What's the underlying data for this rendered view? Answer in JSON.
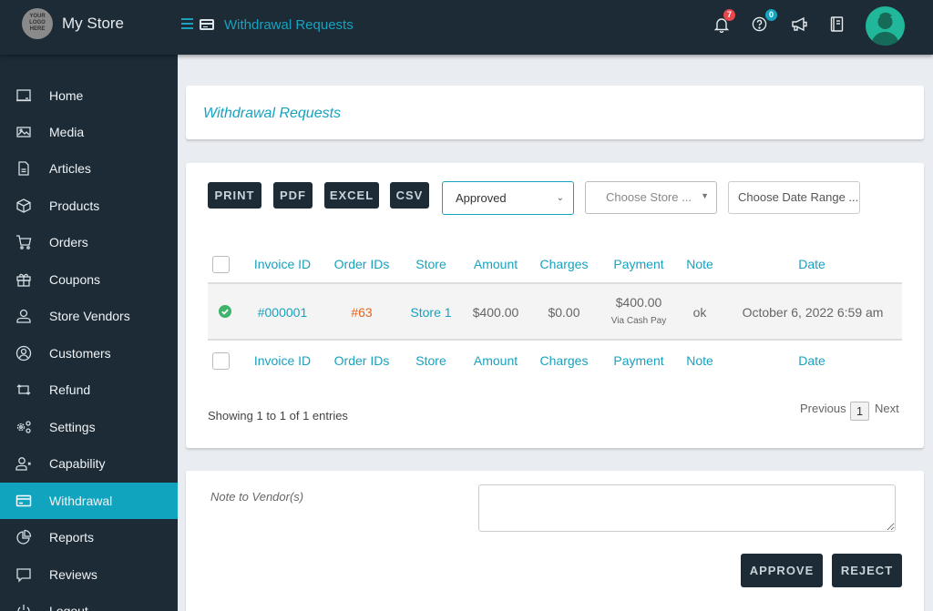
{
  "header": {
    "logo_text": "YOUR LOGO HERE",
    "store_name": "My Store",
    "page_title": "Withdrawal Requests",
    "notifications_count": "7",
    "help_count": "0",
    "colors": {
      "accent": "#17a2c0",
      "dark": "#1c2b36",
      "notif_badge": "#e8474b",
      "help_badge": "#17a2c0",
      "avatar": "#20b79a"
    }
  },
  "sidebar": {
    "items": [
      {
        "label": "Home",
        "icon": "monitor-icon"
      },
      {
        "label": "Media",
        "icon": "image-icon"
      },
      {
        "label": "Articles",
        "icon": "document-icon"
      },
      {
        "label": "Products",
        "icon": "box-icon"
      },
      {
        "label": "Orders",
        "icon": "cart-icon"
      },
      {
        "label": "Coupons",
        "icon": "gift-icon"
      },
      {
        "label": "Store Vendors",
        "icon": "user-icon"
      },
      {
        "label": "Customers",
        "icon": "user-circle-icon"
      },
      {
        "label": "Refund",
        "icon": "refund-icon"
      },
      {
        "label": "Settings",
        "icon": "gears-icon"
      },
      {
        "label": "Capability",
        "icon": "user-x-icon"
      },
      {
        "label": "Withdrawal",
        "icon": "credit-card-icon",
        "active": true
      },
      {
        "label": "Reports",
        "icon": "pie-chart-icon"
      },
      {
        "label": "Reviews",
        "icon": "comment-icon"
      },
      {
        "label": "Logout",
        "icon": "power-icon"
      }
    ]
  },
  "title_card": {
    "title": "Withdrawal Requests"
  },
  "toolbar": {
    "print": "PRINT",
    "pdf": "PDF",
    "excel": "EXCEL",
    "csv": "CSV",
    "status_select": "Approved",
    "store_placeholder": "Choose Store ...",
    "date_range_placeholder": "Choose Date Range ..."
  },
  "table": {
    "columns": [
      "Invoice ID",
      "Order IDs",
      "Store",
      "Amount",
      "Charges",
      "Payment",
      "Note",
      "Date"
    ],
    "rows": [
      {
        "status": "approved",
        "invoice_id": "#000001",
        "order_ids": "#63",
        "store": "Store 1",
        "amount": "$400.00",
        "charges": "$0.00",
        "payment": "$400.00",
        "payment_method": "Via Cash Pay",
        "note": "ok",
        "date": "October 6, 2022 6:59 am"
      }
    ],
    "info": "Showing 1 to 1 of 1 entries",
    "pagination": {
      "previous": "Previous",
      "current": "1",
      "next": "Next"
    }
  },
  "note_card": {
    "label": "Note to Vendor(s)",
    "value": "",
    "approve": "APPROVE",
    "reject": "REJECT"
  }
}
